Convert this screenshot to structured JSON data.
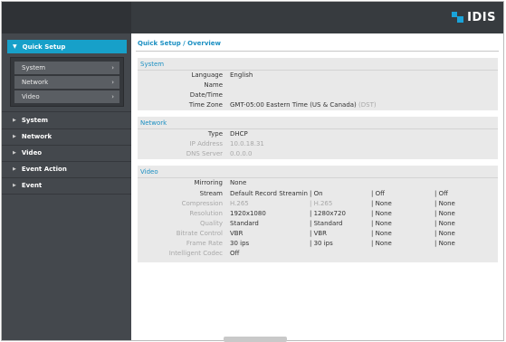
{
  "brand": {
    "logo_text": "IDIS",
    "accent": "#1aa3d9"
  },
  "sidebar": {
    "active_section": "Quick Setup",
    "subitems": [
      "System",
      "Network",
      "Video"
    ],
    "items": [
      "System",
      "Network",
      "Video",
      "Event Action",
      "Event"
    ]
  },
  "page": {
    "title": "Quick Setup / Overview"
  },
  "system_panel": {
    "title": "System",
    "rows": [
      {
        "label": "Language",
        "value": "English"
      },
      {
        "label": "Name",
        "value": ""
      },
      {
        "label": "Date/Time",
        "value": ""
      },
      {
        "label": "Time Zone",
        "value": "GMT-05:00 Eastern Time (US & Canada)",
        "suffix": "(DST)"
      }
    ]
  },
  "network_panel": {
    "title": "Network",
    "rows": [
      {
        "label": "Type",
        "value": "DHCP"
      },
      {
        "label": "IP Address",
        "value": "10.0.18.31"
      },
      {
        "label": "DNS Server",
        "value": "0.0.0.0"
      }
    ]
  },
  "video_panel": {
    "title": "Video",
    "mirroring": {
      "label": "Mirroring",
      "value": "None"
    },
    "stream_rows": [
      {
        "label": "Stream",
        "cells": [
          "Default Record Streaming",
          "On",
          "Off",
          "Off"
        ]
      },
      {
        "label": "Compression",
        "cells": [
          "H.265",
          "H.265",
          "None",
          "None"
        ]
      },
      {
        "label": "Resolution",
        "cells": [
          "1920x1080",
          "1280x720",
          "None",
          "None"
        ]
      },
      {
        "label": "Quality",
        "cells": [
          "Standard",
          "Standard",
          "None",
          "None"
        ]
      },
      {
        "label": "Bitrate Control",
        "cells": [
          "VBR",
          "VBR",
          "None",
          "None"
        ]
      },
      {
        "label": "Frame Rate",
        "cells": [
          "30 ips",
          "30 ips",
          "None",
          "None"
        ]
      }
    ],
    "intelligent_codec": {
      "label": "Intelligent Codec",
      "value": "Off"
    }
  }
}
